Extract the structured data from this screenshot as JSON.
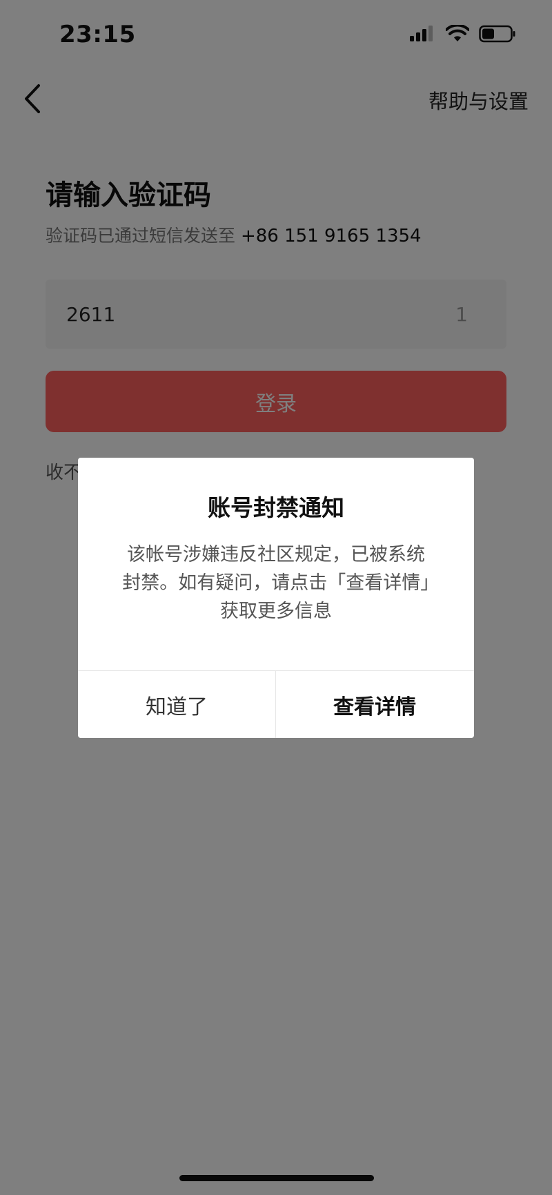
{
  "status_bar": {
    "time": "23:15",
    "icons": [
      "signal-icon",
      "wifi-icon",
      "battery-icon"
    ]
  },
  "nav": {
    "back_icon": "chevron-left-icon",
    "help_label": "帮助与设置"
  },
  "verification": {
    "title": "请输入验证码",
    "subtitle_prefix": "验证码已通过短信发送至 ",
    "phone": "+86 151 9165 1354",
    "code_value": "2611",
    "countdown": "1",
    "login_label": "登录",
    "no_code_label": "收不"
  },
  "dialog": {
    "title": "账号封禁通知",
    "message": "该帐号涉嫌违反社区规定，已被系统封禁。如有疑问，请点击「查看详情」获取更多信息",
    "dismiss_label": "知道了",
    "details_label": "查看详情"
  },
  "colors": {
    "primary_red": "#fe2c2a",
    "overlay": "rgba(0,0,0,0.5)"
  }
}
